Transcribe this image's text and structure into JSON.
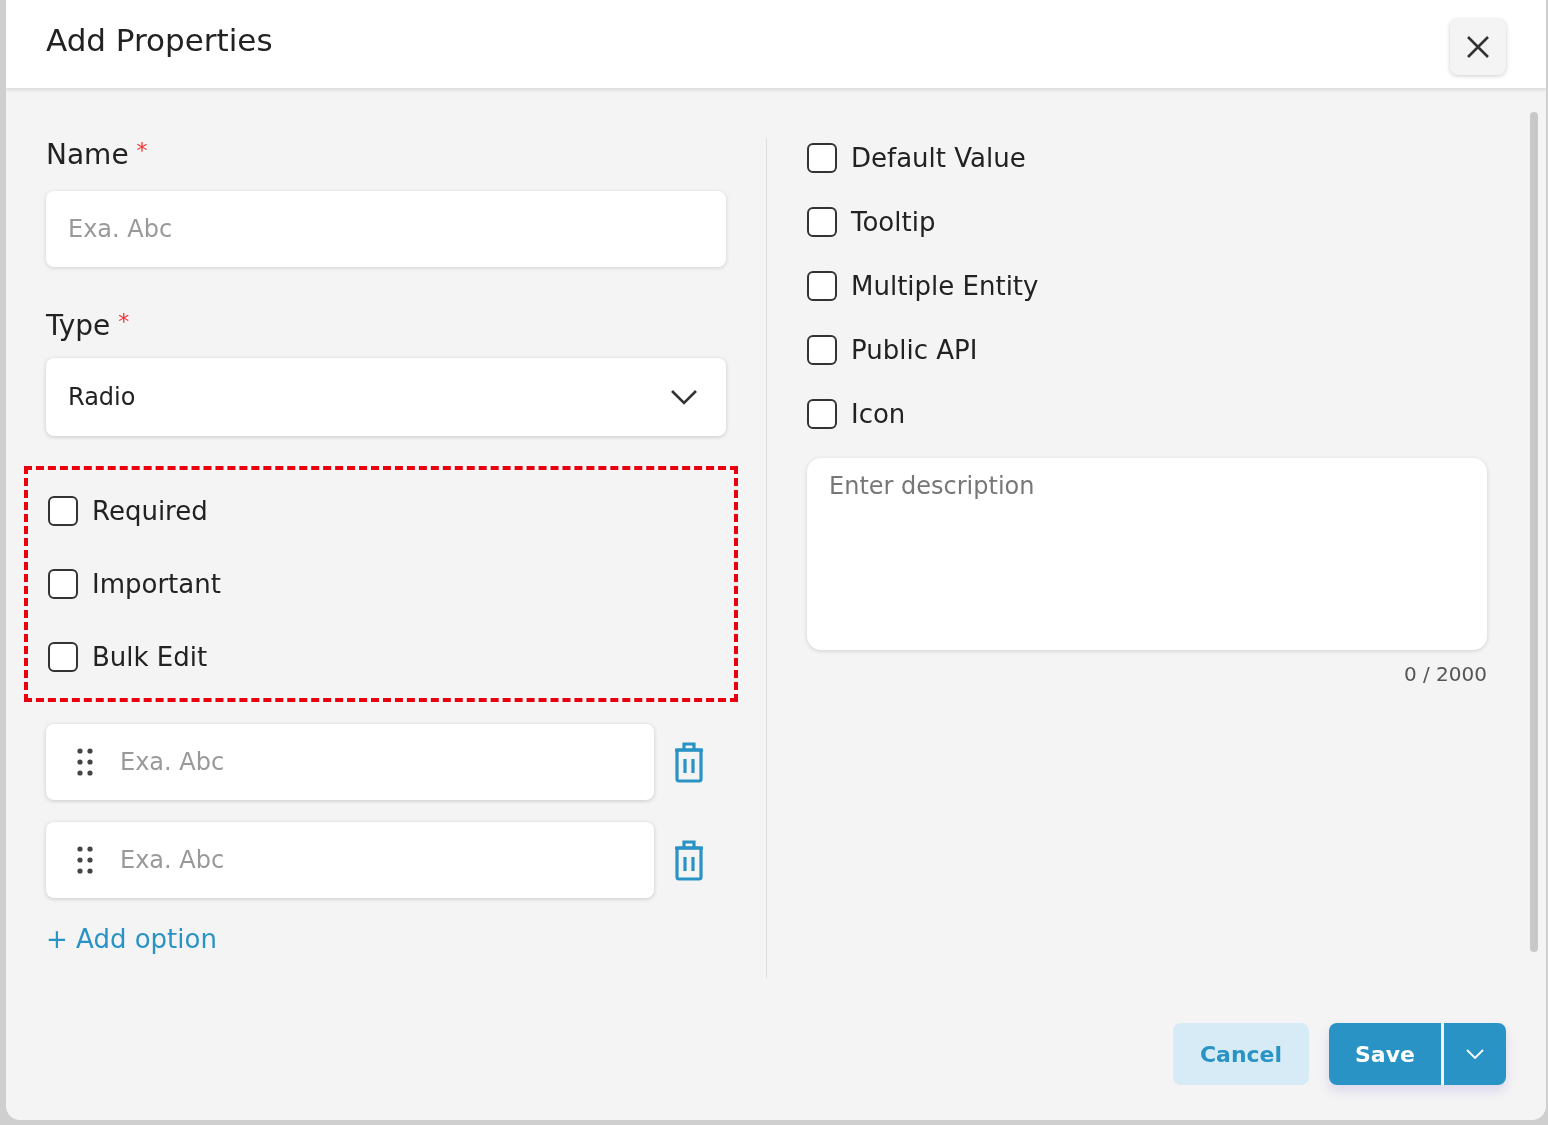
{
  "dialog": {
    "title": "Add Properties"
  },
  "name_field": {
    "label": "Name",
    "required_mark": "*",
    "placeholder": "Exa. Abc"
  },
  "type_field": {
    "label": "Type",
    "required_mark": "*",
    "value": "Radio"
  },
  "flags": [
    {
      "label": "Required",
      "checked": false
    },
    {
      "label": "Important",
      "checked": false
    },
    {
      "label": "Bulk Edit",
      "checked": false
    }
  ],
  "options": [
    {
      "placeholder": "Exa. Abc"
    },
    {
      "placeholder": "Exa. Abc"
    }
  ],
  "add_option": "+ Add option",
  "settings": [
    {
      "label": "Default Value",
      "checked": false
    },
    {
      "label": "Tooltip",
      "checked": false
    },
    {
      "label": "Multiple Entity",
      "checked": false
    },
    {
      "label": "Public API",
      "checked": false
    },
    {
      "label": "Icon",
      "checked": false
    }
  ],
  "description": {
    "placeholder": "Enter description",
    "counter": "0 / 2000"
  },
  "buttons": {
    "cancel": "Cancel",
    "save": "Save"
  }
}
